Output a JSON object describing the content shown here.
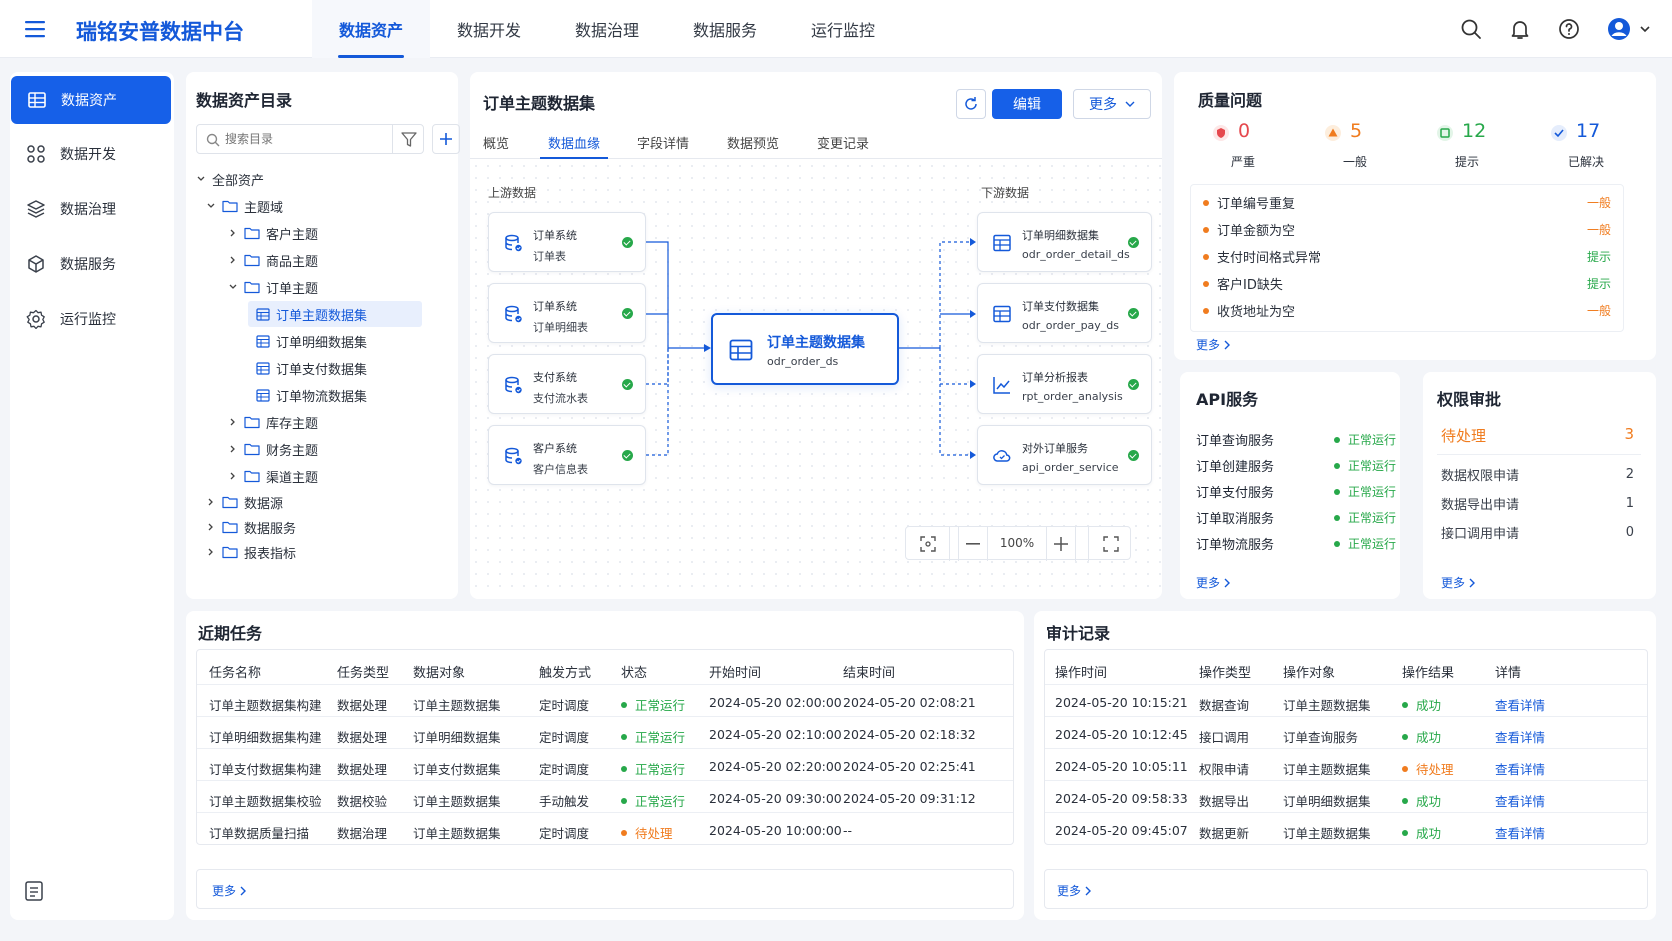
{
  "app": {
    "title": "瑞铭安普数据中台"
  },
  "nav": [
    {
      "label": "数据资产"
    },
    {
      "label": "数据开发"
    },
    {
      "label": "数据治理"
    },
    {
      "label": "数据服务"
    },
    {
      "label": "运行监控"
    }
  ],
  "sidebar": [
    {
      "label": "数据资产"
    },
    {
      "label": "数据开发"
    },
    {
      "label": "数据治理"
    },
    {
      "label": "数据服务"
    },
    {
      "label": "运行监控"
    }
  ],
  "catalog": {
    "title": "数据资产目录",
    "search_placeholder": "搜索目录",
    "tree": [
      {
        "label": "全部资产"
      },
      {
        "label": "主题域"
      },
      {
        "label": "客户主题"
      },
      {
        "label": "商品主题"
      },
      {
        "label": "订单主题"
      },
      {
        "label": "订单主题数据集"
      },
      {
        "label": "订单明细数据集"
      },
      {
        "label": "订单支付数据集"
      },
      {
        "label": "订单物流数据集"
      },
      {
        "label": "库存主题"
      },
      {
        "label": "财务主题"
      },
      {
        "label": "渠道主题"
      },
      {
        "label": "数据源"
      },
      {
        "label": "数据服务"
      },
      {
        "label": "报表指标"
      }
    ]
  },
  "dataset": {
    "title": "订单主题数据集",
    "edit_label": "编辑",
    "more_label": "更多",
    "tabs": [
      {
        "label": "概览"
      },
      {
        "label": "数据血缘"
      },
      {
        "label": "字段详情"
      },
      {
        "label": "数据预览"
      },
      {
        "label": "变更记录"
      }
    ],
    "upstream_label": "上游数据",
    "downstream_label": "下游数据",
    "upstream": [
      {
        "line1": "订单系统",
        "line2": "订单表"
      },
      {
        "line1": "订单系统",
        "line2": "订单明细表"
      },
      {
        "line1": "支付系统",
        "line2": "支付流水表"
      },
      {
        "line1": "客户系统",
        "line2": "客户信息表"
      }
    ],
    "center": {
      "title": "订单主题数据集",
      "code": "odr_order_ds"
    },
    "downstream": [
      {
        "line1": "订单明细数据集",
        "line2": "odr_order_detail_ds",
        "icon": "table-icon"
      },
      {
        "line1": "订单支付数据集",
        "line2": "odr_order_pay_ds",
        "icon": "table-icon"
      },
      {
        "line1": "订单分析报表",
        "line2": "rpt_order_analysis",
        "icon": "chart-icon"
      },
      {
        "line1": "对外订单服务",
        "line2": "api_order_service",
        "icon": "cloud-icon"
      }
    ],
    "zoom": "100%"
  },
  "quality": {
    "title": "质量问题",
    "stats": [
      {
        "value": "0",
        "label": "严重",
        "color": "#e5484d"
      },
      {
        "value": "5",
        "label": "一般",
        "color": "#f07c1f"
      },
      {
        "value": "12",
        "label": "提示",
        "color": "#27a84a"
      },
      {
        "value": "17",
        "label": "已解决",
        "color": "#1459d9"
      }
    ],
    "issues": [
      {
        "name": "订单编号重复",
        "level": "一般",
        "color": "#f07c1f"
      },
      {
        "name": "订单金额为空",
        "level": "一般",
        "color": "#f07c1f"
      },
      {
        "name": "支付时间格式异常",
        "level": "提示",
        "color": "#27a84a"
      },
      {
        "name": "客户ID缺失",
        "level": "提示",
        "color": "#27a84a"
      },
      {
        "name": "收货地址为空",
        "level": "一般",
        "color": "#f07c1f"
      }
    ],
    "more": "更多"
  },
  "api": {
    "title": "API服务",
    "items": [
      {
        "name": "订单查询服务",
        "status": "正常运行"
      },
      {
        "name": "订单创建服务",
        "status": "正常运行"
      },
      {
        "name": "订单支付服务",
        "status": "正常运行"
      },
      {
        "name": "订单取消服务",
        "status": "正常运行"
      },
      {
        "name": "订单物流服务",
        "status": "正常运行"
      }
    ],
    "more": "更多"
  },
  "approval": {
    "title": "权限审批",
    "pending_label": "待处理",
    "pending_count": "3",
    "items": [
      {
        "name": "数据权限申请",
        "count": "2"
      },
      {
        "name": "数据导出申请",
        "count": "1"
      },
      {
        "name": "接口调用申请",
        "count": "0"
      }
    ],
    "more": "更多"
  },
  "tasks": {
    "title": "近期任务",
    "headers": [
      "任务名称",
      "任务类型",
      "数据对象",
      "触发方式",
      "状态",
      "开始时间",
      "结束时间"
    ],
    "rows": [
      {
        "name": "订单主题数据集构建",
        "type": "数据处理",
        "obj": "订单主题数据集",
        "trigger": "定时调度",
        "status": "正常运行",
        "status_color": "#27a84a",
        "start": "2024-05-20 02:00:00",
        "end": "2024-05-20 02:08:21"
      },
      {
        "name": "订单明细数据集构建",
        "type": "数据处理",
        "obj": "订单明细数据集",
        "trigger": "定时调度",
        "status": "正常运行",
        "status_color": "#27a84a",
        "start": "2024-05-20 02:10:00",
        "end": "2024-05-20 02:18:32"
      },
      {
        "name": "订单支付数据集构建",
        "type": "数据处理",
        "obj": "订单支付数据集",
        "trigger": "定时调度",
        "status": "正常运行",
        "status_color": "#27a84a",
        "start": "2024-05-20 02:20:00",
        "end": "2024-05-20 02:25:41"
      },
      {
        "name": "订单主题数据集校验",
        "type": "数据校验",
        "obj": "订单主题数据集",
        "trigger": "手动触发",
        "status": "正常运行",
        "status_color": "#27a84a",
        "start": "2024-05-20 09:30:00",
        "end": "2024-05-20 09:31:12"
      },
      {
        "name": "订单数据质量扫描",
        "type": "数据治理",
        "obj": "订单主题数据集",
        "trigger": "定时调度",
        "status": "待处理",
        "status_color": "#f07c1f",
        "start": "2024-05-20 10:00:00",
        "end": "--"
      }
    ],
    "more": "更多"
  },
  "audit": {
    "title": "审计记录",
    "headers": [
      "操作时间",
      "操作类型",
      "操作对象",
      "操作结果",
      "详情"
    ],
    "rows": [
      {
        "time": "2024-05-20 10:15:21",
        "type": "数据查询",
        "obj": "订单主题数据集",
        "result": "成功",
        "result_color": "#27a84a",
        "detail": "查看详情"
      },
      {
        "time": "2024-05-20 10:12:45",
        "type": "接口调用",
        "obj": "订单查询服务",
        "result": "成功",
        "result_color": "#27a84a",
        "detail": "查看详情"
      },
      {
        "time": "2024-05-20 10:05:11",
        "type": "权限申请",
        "obj": "订单主题数据集",
        "result": "待处理",
        "result_color": "#f07c1f",
        "detail": "查看详情"
      },
      {
        "time": "2024-05-20 09:58:33",
        "type": "数据导出",
        "obj": "订单明细数据集",
        "result": "成功",
        "result_color": "#27a84a",
        "detail": "查看详情"
      },
      {
        "time": "2024-05-20 09:45:07",
        "type": "数据更新",
        "obj": "订单主题数据集",
        "result": "成功",
        "result_color": "#27a84a",
        "detail": "查看详情"
      }
    ],
    "more": "更多"
  },
  "colors": {
    "primary": "#1459d9",
    "success": "#27a84a",
    "warning": "#f07c1f",
    "danger": "#e5484d"
  }
}
